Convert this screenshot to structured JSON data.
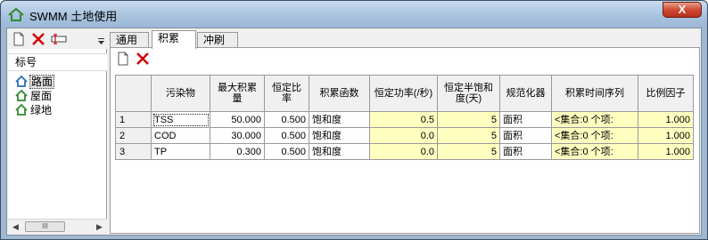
{
  "window": {
    "title": "SWMM 土地使用",
    "close_label": "X"
  },
  "left_panel": {
    "header": "标号",
    "items": [
      {
        "label": "路面",
        "selected": true
      },
      {
        "label": "屋面",
        "selected": false
      },
      {
        "label": "绿地",
        "selected": false
      }
    ],
    "scroll_thumb": "III"
  },
  "tabs": [
    {
      "label": "通用",
      "active": false
    },
    {
      "label": "积累",
      "active": true
    },
    {
      "label": "冲刷",
      "active": false
    }
  ],
  "table": {
    "columns": [
      "污染物",
      "最大积累量",
      "恒定比率",
      "积累函数",
      "恒定功率(/秒)",
      "恒定半饱和度(天)",
      "规范化器",
      "积累时间序列",
      "比例因子"
    ],
    "rows": [
      {
        "index": "1",
        "pollutant": "TSS",
        "max_buildup": "50.000",
        "rate_const": "0.500",
        "function": "饱和度",
        "power_const": "0.5",
        "half_sat": "5",
        "normalizer": "面积",
        "time_series": "<集合:0 个项:",
        "scale_factor": "1.000"
      },
      {
        "index": "2",
        "pollutant": "COD",
        "max_buildup": "30.000",
        "rate_const": "0.500",
        "function": "饱和度",
        "power_const": "0.0",
        "half_sat": "5",
        "normalizer": "面积",
        "time_series": "<集合:0 个项:",
        "scale_factor": "1.000"
      },
      {
        "index": "3",
        "pollutant": "TP",
        "max_buildup": "0.300",
        "rate_const": "0.500",
        "function": "饱和度",
        "power_const": "0.0",
        "half_sat": "5",
        "normalizer": "面积",
        "time_series": "<集合:0 个项:",
        "scale_factor": "1.000"
      }
    ]
  },
  "colors": {
    "accent_yellow": "#ffffc0",
    "delete_red": "#d40000",
    "landuse_icon_blue": "#2a6db5",
    "landuse_icon_green": "#2f8a2f"
  },
  "icons": [
    "new-document-icon",
    "delete-icon",
    "rename-icon",
    "dropdown-arrow-icon",
    "landuse-house-icon"
  ]
}
